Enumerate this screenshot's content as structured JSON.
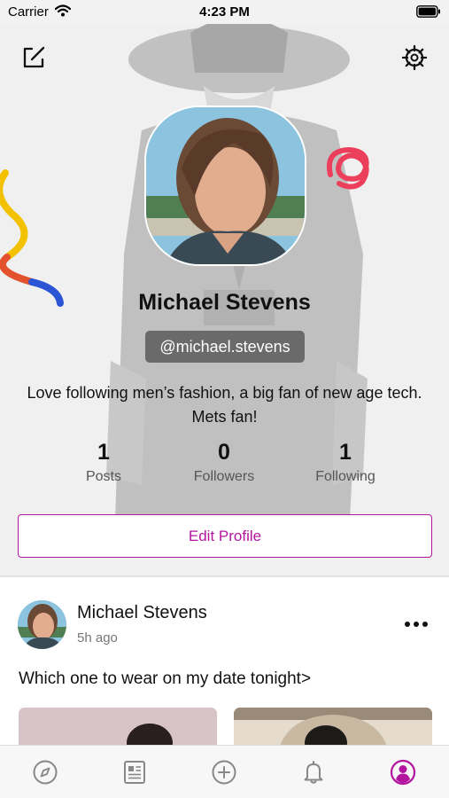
{
  "status_bar": {
    "carrier": "Carrier",
    "time": "4:23 PM"
  },
  "profile": {
    "name": "Michael Stevens",
    "handle": "@michael.stevens",
    "bio": "Love following men’s fashion, a big fan of new age tech. Mets fan!",
    "stats": [
      {
        "value": "1",
        "label": "Posts"
      },
      {
        "value": "0",
        "label": "Followers"
      },
      {
        "value": "1",
        "label": "Following"
      }
    ],
    "edit_button_label": "Edit Profile"
  },
  "post": {
    "author": "Michael Stevens",
    "time": "5h ago",
    "caption": "Which one to wear on my date tonight>"
  },
  "tab_bar": {
    "items": [
      "compass-icon",
      "news-icon",
      "add-icon",
      "bell-icon",
      "profile-icon"
    ],
    "active": "profile-icon"
  },
  "colors": {
    "accent": "#b3159f",
    "header_bg": "#e4e4e4"
  }
}
